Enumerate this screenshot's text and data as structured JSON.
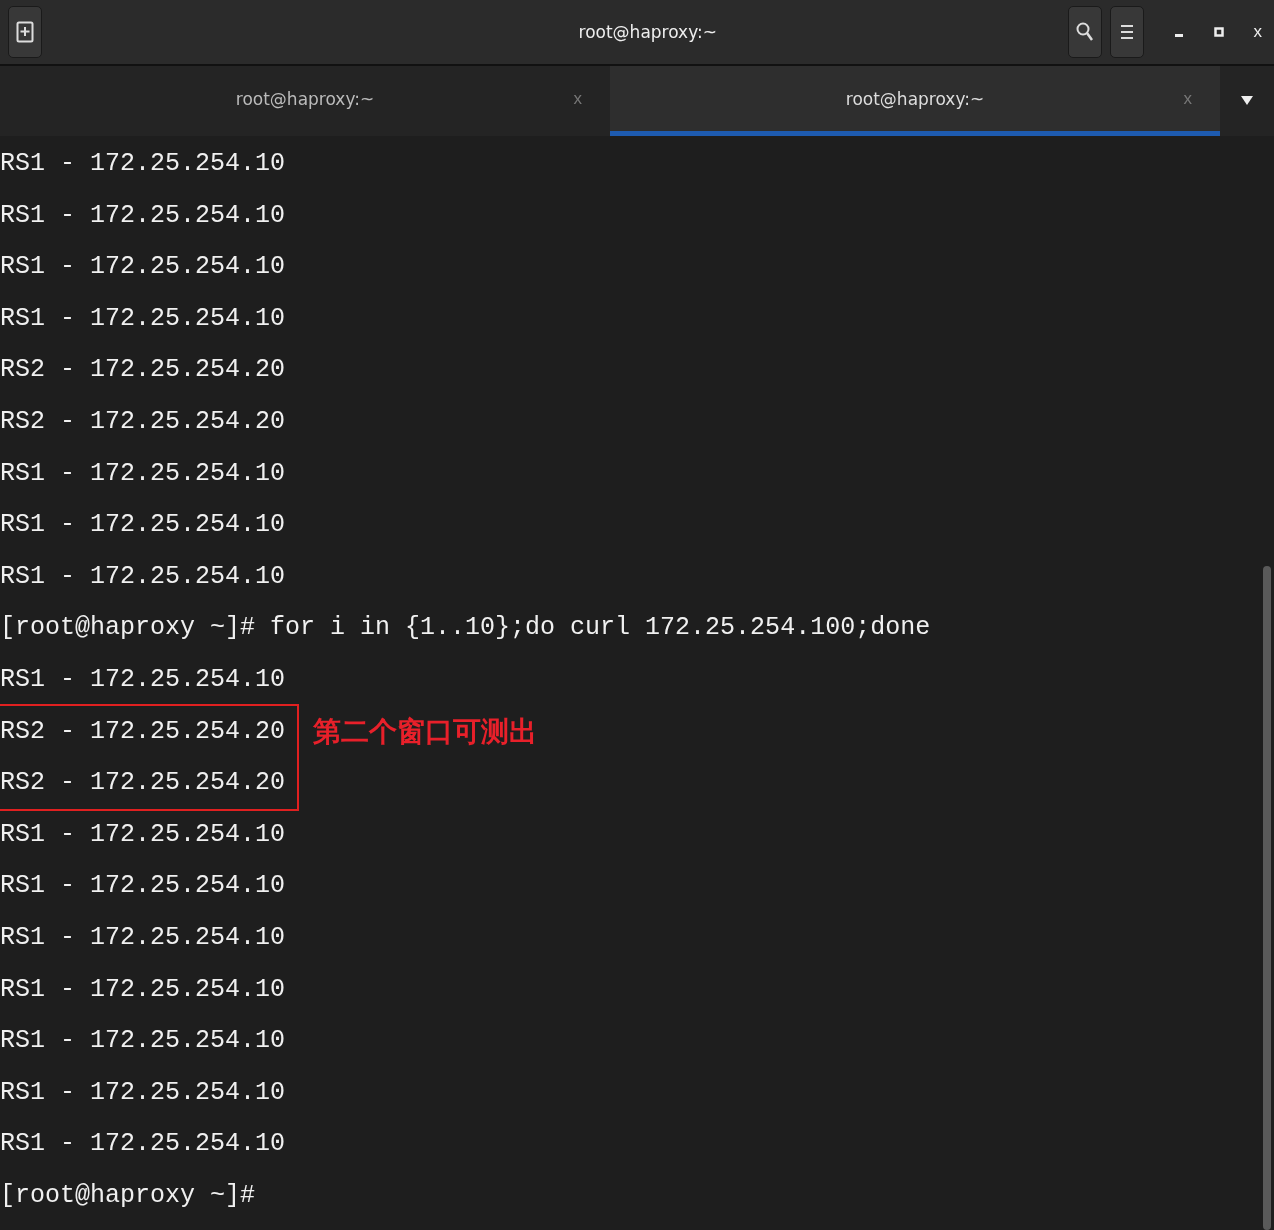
{
  "window": {
    "title": "root@haproxy:~"
  },
  "tabs": [
    {
      "label": "root@haproxy:~",
      "close": "x",
      "selected": false
    },
    {
      "label": "root@haproxy:~",
      "close": "x",
      "selected": true
    }
  ],
  "window_controls": {
    "close": "x"
  },
  "terminal": {
    "blocks": [
      {
        "highlighted": false,
        "lines": [
          "RS1 - 172.25.254.10",
          "RS1 - 172.25.254.10",
          "RS1 - 172.25.254.10",
          "RS1 - 172.25.254.10",
          "RS2 - 172.25.254.20",
          "RS2 - 172.25.254.20",
          "RS1 - 172.25.254.10",
          "RS1 - 172.25.254.10",
          "RS1 - 172.25.254.10",
          "[root@haproxy ~]# for i in {1..10};do curl 172.25.254.100;done",
          "RS1 - 172.25.254.10"
        ]
      },
      {
        "highlighted": true,
        "note": "第二个窗口可测出",
        "lines": [
          "RS2 - 172.25.254.20",
          "RS2 - 172.25.254.20"
        ]
      },
      {
        "highlighted": false,
        "lines": [
          "RS1 - 172.25.254.10",
          "RS1 - 172.25.254.10",
          "RS1 - 172.25.254.10",
          "RS1 - 172.25.254.10",
          "RS1 - 172.25.254.10",
          "RS1 - 172.25.254.10",
          "RS1 - 172.25.254.10",
          "[root@haproxy ~]#"
        ]
      }
    ]
  }
}
